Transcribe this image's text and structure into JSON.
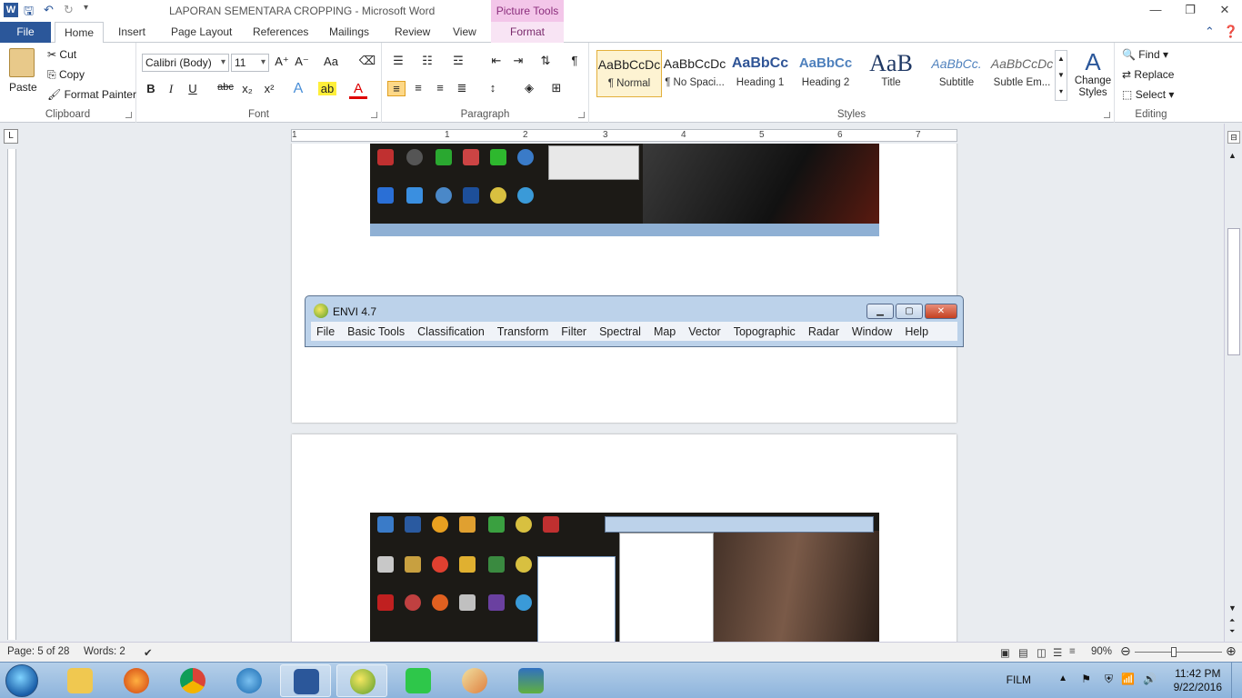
{
  "window": {
    "title": "LAPORAN SEMENTARA CROPPING  -  Microsoft Word",
    "context_tab_group": "Picture Tools",
    "controls": [
      "—",
      "❐",
      "✕"
    ]
  },
  "tabs": [
    "File",
    "Home",
    "Insert",
    "Page Layout",
    "References",
    "Mailings",
    "Review",
    "View",
    "Format"
  ],
  "ribbon": {
    "clipboard": {
      "label": "Clipboard",
      "paste": "Paste",
      "cut": "Cut",
      "copy": "Copy",
      "format_painter": "Format Painter"
    },
    "font": {
      "label": "Font",
      "family": "Calibri (Body)",
      "size": "11"
    },
    "paragraph": {
      "label": "Paragraph"
    },
    "styles": {
      "label": "Styles",
      "items": [
        {
          "preview": "AaBbCcDc",
          "name": "¶ Normal"
        },
        {
          "preview": "AaBbCcDc",
          "name": "¶ No Spaci..."
        },
        {
          "preview": "AaBbCc",
          "name": "Heading 1"
        },
        {
          "preview": "AaBbCc",
          "name": "Heading 2"
        },
        {
          "preview": "AaB",
          "name": "Title"
        },
        {
          "preview": "AaBbCc.",
          "name": "Subtitle"
        },
        {
          "preview": "AaBbCcDc",
          "name": "Subtle Em..."
        }
      ],
      "change_styles": "Change Styles"
    },
    "editing": {
      "label": "Editing",
      "find": "Find",
      "replace": "Replace",
      "select": "Select"
    }
  },
  "ruler": {
    "numbers": [
      "1",
      "1",
      "2",
      "3",
      "4",
      "5",
      "6",
      "7"
    ]
  },
  "envi": {
    "title": "ENVI 4.7",
    "menu": [
      "File",
      "Basic Tools",
      "Classification",
      "Transform",
      "Filter",
      "Spectral",
      "Map",
      "Vector",
      "Topographic",
      "Radar",
      "Window",
      "Help"
    ]
  },
  "status": {
    "page": "Page: 5 of 28",
    "words": "Words: 2",
    "zoom": "90%"
  },
  "tray": {
    "lang": "FILM",
    "time": "11:42 PM",
    "date": "9/22/2016"
  },
  "colors": {
    "word_blue": "#2b579a",
    "picture_tools": "#f3c6e9",
    "taskbar": "#9dbfe2"
  }
}
